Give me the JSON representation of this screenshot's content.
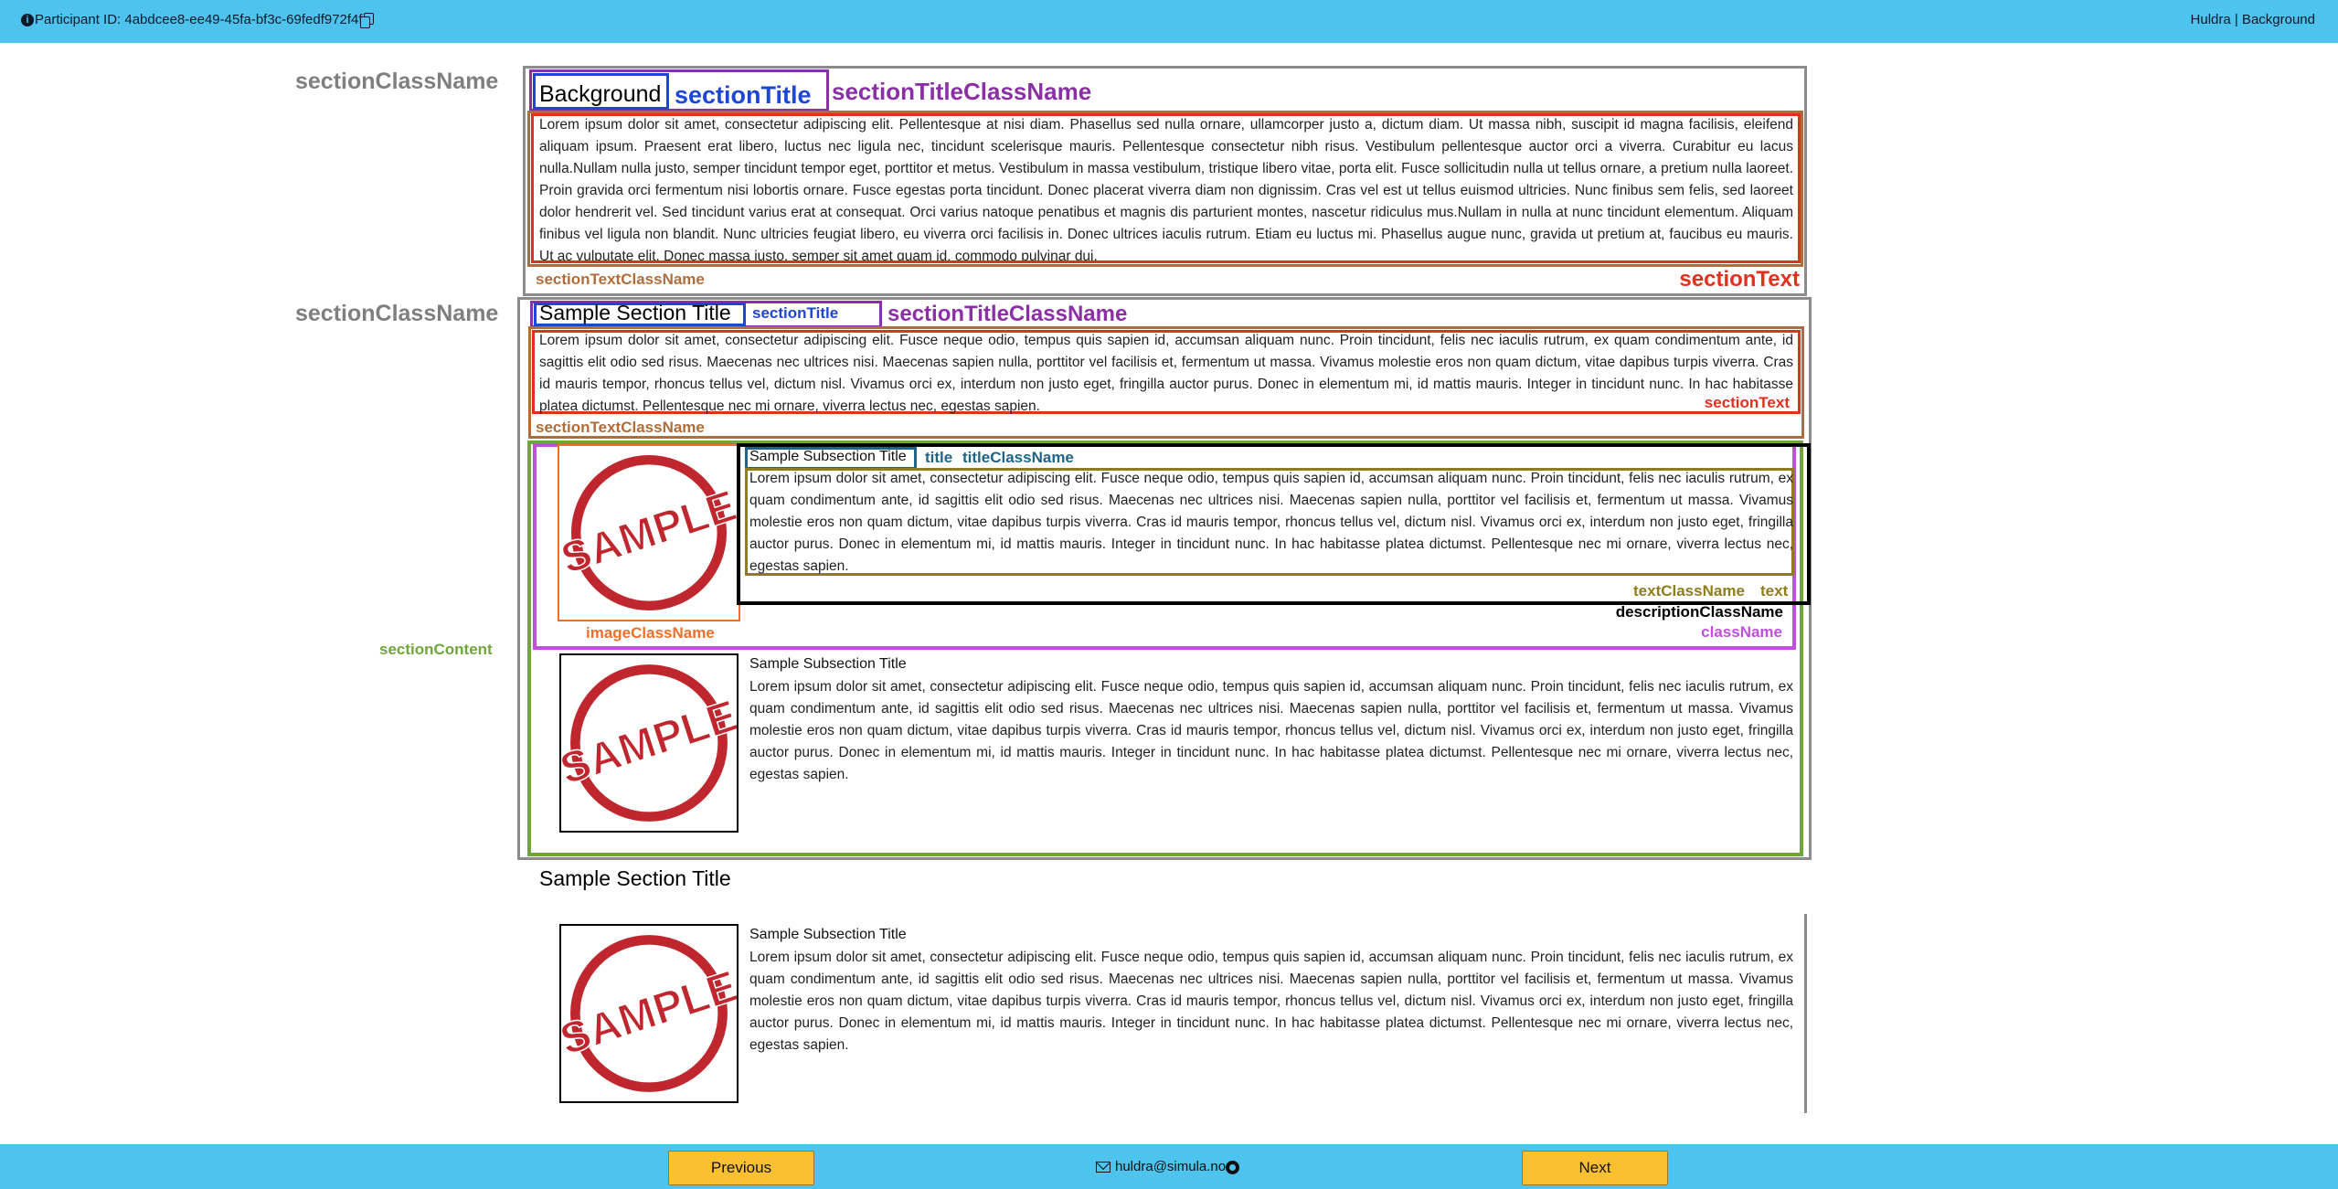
{
  "header": {
    "participant_label": "Participant ID: 4abdcee8-ee49-45fa-bf3c-69fedf972f4f",
    "brand": "Huldra | Background",
    "info_icon": "info-icon",
    "copy_icon": "copy-icon"
  },
  "annotations": {
    "section_class_name": "sectionClassName",
    "section_title": "sectionTitle",
    "section_title_class_name": "sectionTitleClassName",
    "section_text_class_name": "sectionTextClassName",
    "section_text": "sectionText",
    "section_content": "sectionContent",
    "title": "title",
    "title_class_name": "titleClassName",
    "text_class_name": "textClassName",
    "text": "text",
    "description_class_name": "descriptionClassName",
    "image_class_name": "imageClassName",
    "class_name": "className"
  },
  "section1": {
    "title": "Background",
    "text": "Lorem ipsum dolor sit amet, consectetur adipiscing elit. Pellentesque at nisi diam. Phasellus sed nulla ornare, ullamcorper justo a, dictum diam. Ut massa nibh, suscipit id magna facilisis, eleifend aliquam ipsum. Praesent erat libero, luctus nec ligula nec, tincidunt scelerisque mauris. Pellentesque consectetur nibh risus. Vestibulum pellentesque auctor orci a viverra. Curabitur eu lacus nulla.Nullam nulla justo, semper tincidunt tempor eget, porttitor et metus. Vestibulum in massa vestibulum, tristique libero vitae, porta elit. Fusce sollicitudin nulla ut tellus ornare, a pretium nulla laoreet. Proin gravida orci fermentum nisi lobortis ornare. Fusce egestas porta tincidunt. Donec placerat viverra diam non dignissim. Cras vel est ut tellus euismod ultricies. Nunc finibus sem felis, sed laoreet dolor hendrerit vel. Sed tincidunt varius erat at consequat. Orci varius natoque penatibus et magnis dis parturient montes, nascetur ridiculus mus.Nullam in nulla at nunc tincidunt elementum. Aliquam finibus vel ligula non blandit. Nunc ultricies feugiat libero, eu viverra orci facilisis in. Donec ultrices iaculis rutrum. Etiam eu luctus mi. Phasellus augue nunc, gravida ut pretium at, faucibus eu mauris. Ut ac vulputate elit. Donec massa justo, semper sit amet quam id, commodo pulvinar dui."
  },
  "section2": {
    "title": "Sample Section Title",
    "text": "Lorem ipsum dolor sit amet, consectetur adipiscing elit. Fusce neque odio, tempus quis sapien id, accumsan aliquam nunc. Proin tincidunt, felis nec iaculis rutrum, ex quam condimentum ante, id sagittis elit odio sed risus. Maecenas nec ultrices nisi. Maecenas sapien nulla, porttitor vel facilisis et, fermentum ut massa. Vivamus molestie eros non quam dictum, vitae dapibus turpis viverra. Cras id mauris tempor, rhoncus tellus vel, dictum nisl. Vivamus orci ex, interdum non justo eget, fringilla auctor purus. Donec in elementum mi, id mattis mauris. Integer in tincidunt nunc. In hac habitasse platea dictumst. Pellentesque nec mi ornare, viverra lectus nec, egestas sapien.",
    "items": [
      {
        "title": "Sample Subsection Title",
        "text": "Lorem ipsum dolor sit amet, consectetur adipiscing elit. Fusce neque odio, tempus quis sapien id, accumsan aliquam nunc. Proin tincidunt, felis nec iaculis rutrum, ex quam condimentum ante, id sagittis elit odio sed risus. Maecenas nec ultrices nisi. Maecenas sapien nulla, porttitor vel facilisis et, fermentum ut massa. Vivamus molestie eros non quam dictum, vitae dapibus turpis viverra. Cras id mauris tempor, rhoncus tellus vel, dictum nisl. Vivamus orci ex, interdum non justo eget, fringilla auctor purus. Donec in elementum mi, id mattis mauris. Integer in tincidunt nunc. In hac habitasse platea dictumst. Pellentesque nec mi ornare, viverra lectus nec, egestas sapien.",
        "image_text": "SAMPLE"
      },
      {
        "title": "Sample Subsection Title",
        "text": "Lorem ipsum dolor sit amet, consectetur adipiscing elit. Fusce neque odio, tempus quis sapien id, accumsan aliquam nunc. Proin tincidunt, felis nec iaculis rutrum, ex quam condimentum ante, id sagittis elit odio sed risus. Maecenas nec ultrices nisi. Maecenas sapien nulla, porttitor vel facilisis et, fermentum ut massa. Vivamus molestie eros non quam dictum, vitae dapibus turpis viverra. Cras id mauris tempor, rhoncus tellus vel, dictum nisl. Vivamus orci ex, interdum non justo eget, fringilla auctor purus. Donec in elementum mi, id mattis mauris. Integer in tincidunt nunc. In hac habitasse platea dictumst. Pellentesque nec mi ornare, viverra lectus nec, egestas sapien.",
        "image_text": "SAMPLE"
      }
    ]
  },
  "section3": {
    "title": "Sample Section Title",
    "items": [
      {
        "title": "Sample Subsection Title",
        "text": "Lorem ipsum dolor sit amet, consectetur adipiscing elit. Fusce neque odio, tempus quis sapien id, accumsan aliquam nunc. Proin tincidunt, felis nec iaculis rutrum, ex quam condimentum ante, id sagittis elit odio sed risus. Maecenas nec ultrices nisi. Maecenas sapien nulla, porttitor vel facilisis et, fermentum ut massa. Vivamus molestie eros non quam dictum, vitae dapibus turpis viverra. Cras id mauris tempor, rhoncus tellus vel, dictum nisl. Vivamus orci ex, interdum non justo eget, fringilla auctor purus. Donec in elementum mi, id mattis mauris. Integer in tincidunt nunc. In hac habitasse platea dictumst. Pellentesque nec mi ornare, viverra lectus nec, egestas sapien.",
        "image_text": "SAMPLE"
      }
    ]
  },
  "footer": {
    "previous_label": "Previous",
    "next_label": "Next",
    "email": "huldra@simula.no",
    "mail_icon": "mail-icon",
    "github_icon": "github-icon"
  },
  "colors": {
    "bar": "#4dc3ee",
    "button": "#fbbf32",
    "stamp": "#c0262d"
  }
}
